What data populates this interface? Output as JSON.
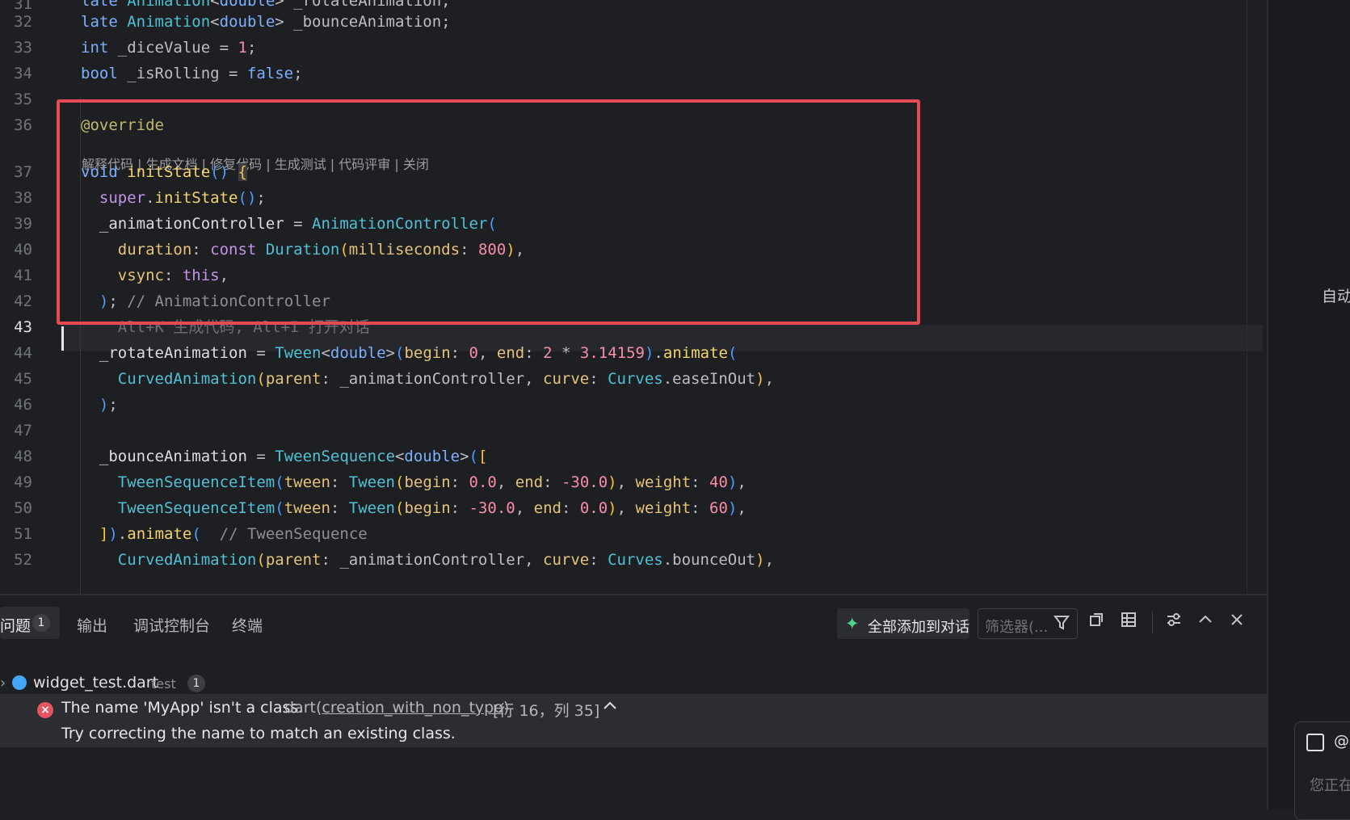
{
  "editor": {
    "line_numbers": [
      "32",
      "33",
      "34",
      "35",
      "36",
      "37",
      "38",
      "39",
      "40",
      "41",
      "42",
      "43",
      "44",
      "45",
      "46",
      "47",
      "48",
      "49",
      "50",
      "51",
      "52"
    ],
    "ai_actions": "解释代码 | 生成文档 | 修复代码 | 生成测试 | 代码评审 | 关闭",
    "ghost_hint": "Alt+K 生成代码, Alt+I 打开对话",
    "comment_animation_controller": "// AnimationController",
    "comment_tween_sequence": "// TweenSequence"
  },
  "bottom_panel": {
    "tabs": {
      "problems": "问题",
      "problems_count": "1",
      "output": "输出",
      "debug_console": "调试控制台",
      "terminal": "终端"
    },
    "add_all_label": "全部添加到对话",
    "filter_placeholder": "筛选器(...",
    "file": {
      "name": "widget_test.dart",
      "folder": "test",
      "count": "1"
    },
    "error": {
      "message": "The name 'MyApp' isn't a class.",
      "source_prefix": "dart(",
      "code": "creation_with_non_type",
      "source_suffix": ")",
      "position": "[行 16，列 35]",
      "hint": "Try correcting the name to match an existing class."
    }
  },
  "right_panel": {
    "auto_label": "自动",
    "chat_at": "@",
    "chat_input_placeholder": "您正在"
  },
  "icons": {
    "ai_sparkle": "sparkle-icon",
    "filter": "filter-icon",
    "collapse": "collapse-all-icon",
    "table": "table-view-icon",
    "settings": "adjust-icon",
    "maximize": "chevron-up-icon",
    "close": "close-icon",
    "error": "error-icon"
  }
}
